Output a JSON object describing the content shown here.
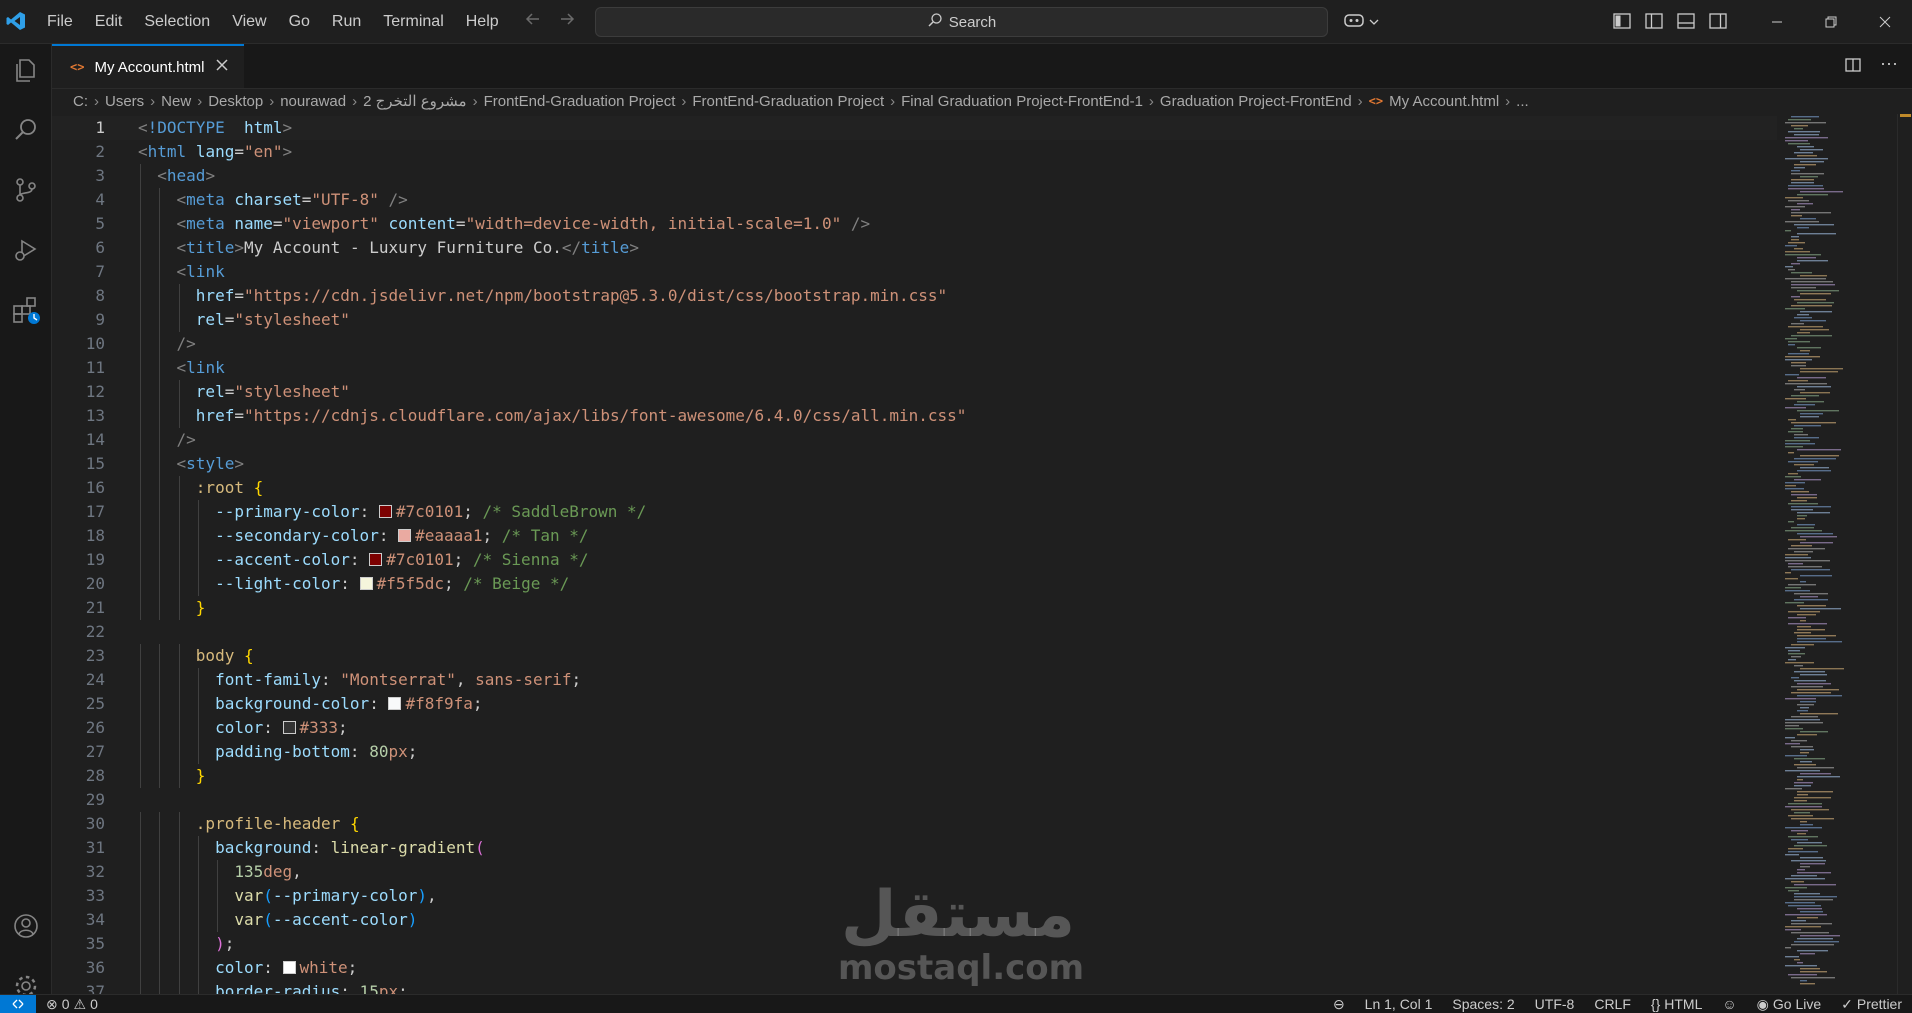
{
  "menu": [
    "File",
    "Edit",
    "Selection",
    "View",
    "Go",
    "Run",
    "Terminal",
    "Help"
  ],
  "search": {
    "label": "Search"
  },
  "tab": {
    "title": "My Account.html"
  },
  "breadcrumb": [
    "C:",
    "Users",
    "New",
    "Desktop",
    "nourawad",
    "مشروع التخرج 2",
    "FrontEnd-Graduation Project",
    "FrontEnd-Graduation Project",
    "Final Graduation Project-FrontEnd-1",
    "Graduation Project-FrontEnd",
    "My Account.html",
    "..."
  ],
  "icons": [
    "vscode-logo-icon",
    "back-arrow-icon",
    "forward-arrow-icon",
    "search-icon",
    "copilot-icon",
    "explorer-icon",
    "run-debug-icon",
    "source-control-icon",
    "extensions-icon",
    "account-icon",
    "settings-gear-icon",
    "html-file-icon",
    "close-icon",
    "split-editor-icon",
    "more-actions-icon"
  ],
  "code_lines": [
    [
      [
        "t-bracket",
        "<"
      ],
      [
        "t-tag",
        "!DOCTYPE"
      ],
      [
        "",
        "  "
      ],
      [
        "t-attr",
        "html"
      ],
      [
        "t-bracket",
        ">"
      ]
    ],
    [
      [
        "t-bracket",
        "<"
      ],
      [
        "t-tag",
        "html"
      ],
      [
        "",
        " "
      ],
      [
        "t-attr",
        "lang"
      ],
      [
        "",
        "="
      ],
      [
        "t-str",
        "\"en\""
      ],
      [
        "t-bracket",
        ">"
      ]
    ],
    [
      [
        "",
        "  "
      ],
      [
        "t-bracket",
        "<"
      ],
      [
        "t-tag",
        "head"
      ],
      [
        "t-bracket",
        ">"
      ]
    ],
    [
      [
        "",
        "    "
      ],
      [
        "t-bracket",
        "<"
      ],
      [
        "t-tag",
        "meta"
      ],
      [
        "",
        " "
      ],
      [
        "t-attr",
        "charset"
      ],
      [
        "",
        "="
      ],
      [
        "t-str",
        "\"UTF-8\""
      ],
      [
        "",
        " "
      ],
      [
        "t-bracket",
        "/>"
      ]
    ],
    [
      [
        "",
        "    "
      ],
      [
        "t-bracket",
        "<"
      ],
      [
        "t-tag",
        "meta"
      ],
      [
        "",
        " "
      ],
      [
        "t-attr",
        "name"
      ],
      [
        "",
        "="
      ],
      [
        "t-str",
        "\"viewport\""
      ],
      [
        "",
        " "
      ],
      [
        "t-attr",
        "content"
      ],
      [
        "",
        "="
      ],
      [
        "t-str",
        "\"width=device-width, initial-scale=1.0\""
      ],
      [
        "",
        " "
      ],
      [
        "t-bracket",
        "/>"
      ]
    ],
    [
      [
        "",
        "    "
      ],
      [
        "t-bracket",
        "<"
      ],
      [
        "t-tag",
        "title"
      ],
      [
        "t-bracket",
        ">"
      ],
      [
        "",
        "My Account - Luxury Furniture Co."
      ],
      [
        "t-bracket",
        "</"
      ],
      [
        "t-tag",
        "title"
      ],
      [
        "t-bracket",
        ">"
      ]
    ],
    [
      [
        "",
        "    "
      ],
      [
        "t-bracket",
        "<"
      ],
      [
        "t-tag",
        "link"
      ]
    ],
    [
      [
        "",
        "      "
      ],
      [
        "t-attr",
        "href"
      ],
      [
        "",
        "="
      ],
      [
        "t-str",
        "\"https://cdn.jsdelivr.net/npm/bootstrap@5.3.0/dist/css/bootstrap.min.css\""
      ]
    ],
    [
      [
        "",
        "      "
      ],
      [
        "t-attr",
        "rel"
      ],
      [
        "",
        "="
      ],
      [
        "t-str",
        "\"stylesheet\""
      ]
    ],
    [
      [
        "",
        "    "
      ],
      [
        "t-bracket",
        "/>"
      ]
    ],
    [
      [
        "",
        "    "
      ],
      [
        "t-bracket",
        "<"
      ],
      [
        "t-tag",
        "link"
      ]
    ],
    [
      [
        "",
        "      "
      ],
      [
        "t-attr",
        "rel"
      ],
      [
        "",
        "="
      ],
      [
        "t-str",
        "\"stylesheet\""
      ]
    ],
    [
      [
        "",
        "      "
      ],
      [
        "t-attr",
        "href"
      ],
      [
        "",
        "="
      ],
      [
        "t-str",
        "\"https://cdnjs.cloudflare.com/ajax/libs/font-awesome/6.4.0/css/all.min.css\""
      ]
    ],
    [
      [
        "",
        "    "
      ],
      [
        "t-bracket",
        "/>"
      ]
    ],
    [
      [
        "",
        "    "
      ],
      [
        "t-bracket",
        "<"
      ],
      [
        "t-tag",
        "style"
      ],
      [
        "t-bracket",
        ">"
      ]
    ],
    [
      [
        "",
        "      "
      ],
      [
        "t-sel",
        ":root"
      ],
      [
        "",
        " "
      ],
      [
        "t-brace1",
        "{"
      ]
    ],
    [
      [
        "",
        "        "
      ],
      [
        "t-prop",
        "--primary-color"
      ],
      [
        "",
        ": "
      ],
      [
        "sw:#7c0101",
        ""
      ],
      [
        "t-val",
        "#7c0101"
      ],
      [
        "",
        "; "
      ],
      [
        "t-com",
        "/* SaddleBrown */"
      ]
    ],
    [
      [
        "",
        "        "
      ],
      [
        "t-prop",
        "--secondary-color"
      ],
      [
        "",
        ": "
      ],
      [
        "sw:#eaaaa1",
        ""
      ],
      [
        "t-val",
        "#eaaaa1"
      ],
      [
        "",
        "; "
      ],
      [
        "t-com",
        "/* Tan */"
      ]
    ],
    [
      [
        "",
        "        "
      ],
      [
        "t-prop",
        "--accent-color"
      ],
      [
        "",
        ": "
      ],
      [
        "sw:#7c0101",
        ""
      ],
      [
        "t-val",
        "#7c0101"
      ],
      [
        "",
        "; "
      ],
      [
        "t-com",
        "/* Sienna */"
      ]
    ],
    [
      [
        "",
        "        "
      ],
      [
        "t-prop",
        "--light-color"
      ],
      [
        "",
        ": "
      ],
      [
        "sw:#f5f5dc",
        ""
      ],
      [
        "t-val",
        "#f5f5dc"
      ],
      [
        "",
        "; "
      ],
      [
        "t-com",
        "/* Beige */"
      ]
    ],
    [
      [
        "",
        "      "
      ],
      [
        "t-brace1",
        "}"
      ]
    ],
    [
      [
        "",
        ""
      ]
    ],
    [
      [
        "",
        "      "
      ],
      [
        "t-sel",
        "body"
      ],
      [
        "",
        " "
      ],
      [
        "t-brace1",
        "{"
      ]
    ],
    [
      [
        "",
        "        "
      ],
      [
        "t-prop",
        "font-family"
      ],
      [
        "",
        ": "
      ],
      [
        "t-str",
        "\"Montserrat\""
      ],
      [
        "",
        ", "
      ],
      [
        "t-val",
        "sans-serif"
      ],
      [
        "",
        ";"
      ]
    ],
    [
      [
        "",
        "        "
      ],
      [
        "t-prop",
        "background-color"
      ],
      [
        "",
        ": "
      ],
      [
        "sw:#f8f9fa",
        ""
      ],
      [
        "t-val",
        "#f8f9fa"
      ],
      [
        "",
        ";"
      ]
    ],
    [
      [
        "",
        "        "
      ],
      [
        "t-prop",
        "color"
      ],
      [
        "",
        ": "
      ],
      [
        "sw:#333333",
        ""
      ],
      [
        "t-val",
        "#333"
      ],
      [
        "",
        ";"
      ]
    ],
    [
      [
        "",
        "        "
      ],
      [
        "t-prop",
        "padding-bottom"
      ],
      [
        "",
        ": "
      ],
      [
        "t-num",
        "80"
      ],
      [
        "t-val",
        "px"
      ],
      [
        "",
        ";"
      ]
    ],
    [
      [
        "",
        "      "
      ],
      [
        "t-brace1",
        "}"
      ]
    ],
    [
      [
        "",
        ""
      ]
    ],
    [
      [
        "",
        "      "
      ],
      [
        "t-sel",
        ".profile-header"
      ],
      [
        "",
        " "
      ],
      [
        "t-brace1",
        "{"
      ]
    ],
    [
      [
        "",
        "        "
      ],
      [
        "t-prop",
        "background"
      ],
      [
        "",
        ": "
      ],
      [
        "t-fn",
        "linear-gradient"
      ],
      [
        "t-brace2",
        "("
      ]
    ],
    [
      [
        "",
        "          "
      ],
      [
        "t-num",
        "135"
      ],
      [
        "t-val",
        "deg"
      ],
      [
        "",
        ","
      ]
    ],
    [
      [
        "",
        "          "
      ],
      [
        "t-fn",
        "var"
      ],
      [
        "t-brace3",
        "("
      ],
      [
        "t-prop",
        "--primary-color"
      ],
      [
        "t-brace3",
        ")"
      ],
      [
        "",
        ","
      ]
    ],
    [
      [
        "",
        "          "
      ],
      [
        "t-fn",
        "var"
      ],
      [
        "t-brace3",
        "("
      ],
      [
        "t-prop",
        "--accent-color"
      ],
      [
        "t-brace3",
        ")"
      ]
    ],
    [
      [
        "",
        "        "
      ],
      [
        "t-brace2",
        ")"
      ],
      [
        "",
        ";"
      ]
    ],
    [
      [
        "",
        "        "
      ],
      [
        "t-prop",
        "color"
      ],
      [
        "",
        ": "
      ],
      [
        "sw:#ffffff",
        ""
      ],
      [
        "t-val",
        "white"
      ],
      [
        "",
        ";"
      ]
    ],
    [
      [
        "",
        "        "
      ],
      [
        "t-prop",
        "border-radius"
      ],
      [
        "",
        ": "
      ],
      [
        "t-num",
        "15"
      ],
      [
        "t-val",
        "px"
      ],
      [
        "",
        ";"
      ]
    ]
  ],
  "status": {
    "errors": "0",
    "warnings": "0",
    "position": "Ln 1, Col 1",
    "spaces": "Spaces: 2",
    "encoding": "UTF-8",
    "eol": "CRLF",
    "language": "HTML",
    "golive": "Go Live",
    "prettier": "Prettier"
  },
  "watermark": {
    "arabic": "مستقل",
    "latin": "mostaql.com"
  },
  "colors": {
    "accent": "#0078d4",
    "editor_bg": "#1f1f1f",
    "sidebar_bg": "#181818"
  }
}
